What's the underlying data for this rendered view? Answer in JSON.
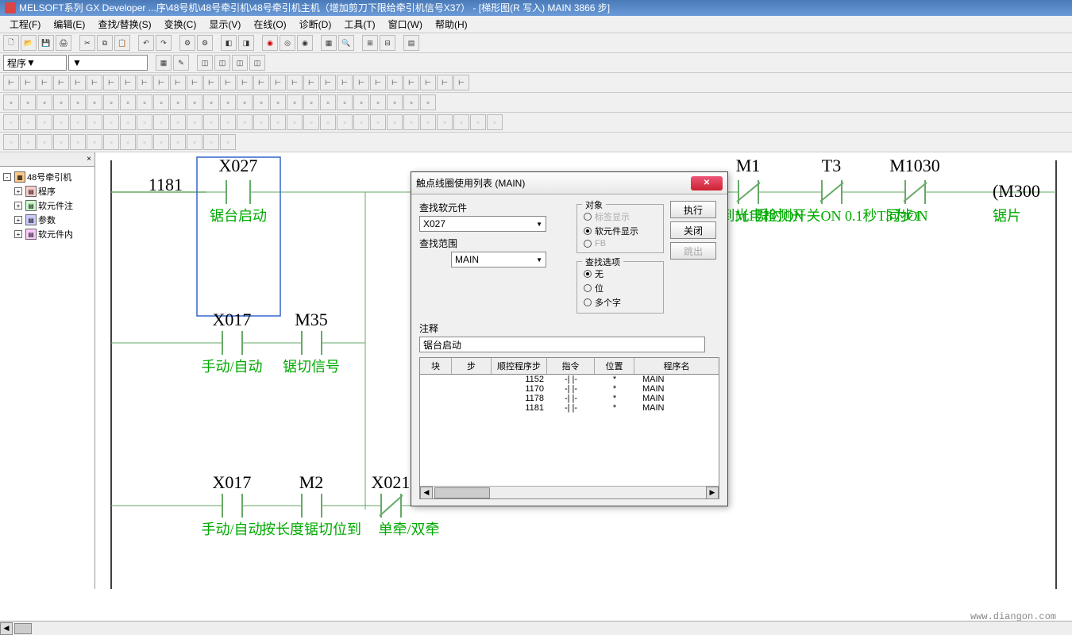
{
  "titlebar": {
    "text": "MELSOFT系列 GX Developer ...序\\48号机\\48号牵引机\\48号牵引机主机（增加剪刀下限给牵引机信号X37） - [梯形图(R 写入)   MAIN   3866 步]"
  },
  "menu": {
    "project": "工程(F)",
    "edit": "编辑(E)",
    "find": "查找/替换(S)",
    "convert": "变换(C)",
    "display": "显示(V)",
    "online": "在线(O)",
    "diagnose": "诊断(D)",
    "tools": "工具(T)",
    "window": "窗口(W)",
    "help": "帮助(H)"
  },
  "combo1": {
    "value": "程序"
  },
  "tree": {
    "root": "48号牵引机",
    "items": [
      "程序",
      "软元件注",
      "参数",
      "软元件内"
    ]
  },
  "ladder": {
    "step1": "1181",
    "x027": "X027",
    "x027_comment": "锯台启动",
    "x017": "X017",
    "x017_comment": "手动/自动",
    "m35": "M35",
    "m35_comment": "锯切信号",
    "x017b": "X017",
    "x017b_comment": "手动/自动",
    "m2": "M2",
    "m2_comment": "按长度锯切位到",
    "x021": "X021",
    "x021_comment": "单牵/双牵",
    "m1": "M1",
    "m1_comment": "切退到M1舜时ON",
    "t3": "T3",
    "t3_comment": "光电检测开关ON 0.1秒T3为ON",
    "m1030": "M1030",
    "m1030_comment": "同步1",
    "m300": "(M300",
    "m300_comment": "锯片"
  },
  "dialog": {
    "title": "触点线圈使用列表 (MAIN)",
    "find_device_label": "查找软元件",
    "find_device_value": "X027",
    "find_range_label": "查找范围",
    "find_range_value": "MAIN",
    "target_label": "对象",
    "target_opt1": "标签显示",
    "target_opt2": "软元件显示",
    "target_opt3": "FB",
    "option_label": "查找选项",
    "option_opt1": "无",
    "option_opt2": "位",
    "option_opt3": "多个字",
    "comment_label": "注释",
    "comment_value": "锯台启动",
    "btn_exec": "执行",
    "btn_close": "关闭",
    "btn_jump": "跳出",
    "cols": {
      "block": "块",
      "step": "步",
      "seq": "顺控程序步",
      "inst": "指令",
      "pos": "位置",
      "prog": "程序名"
    },
    "rows": [
      {
        "step": "1152",
        "inst": "-| |-",
        "pos": "*",
        "prog": "MAIN"
      },
      {
        "step": "1170",
        "inst": "-| |-",
        "pos": "*",
        "prog": "MAIN"
      },
      {
        "step": "1178",
        "inst": "-| |-",
        "pos": "*",
        "prog": "MAIN"
      },
      {
        "step": "1181",
        "inst": "-| |-",
        "pos": "*",
        "prog": "MAIN"
      }
    ]
  },
  "watermark": "www.diangon.com"
}
